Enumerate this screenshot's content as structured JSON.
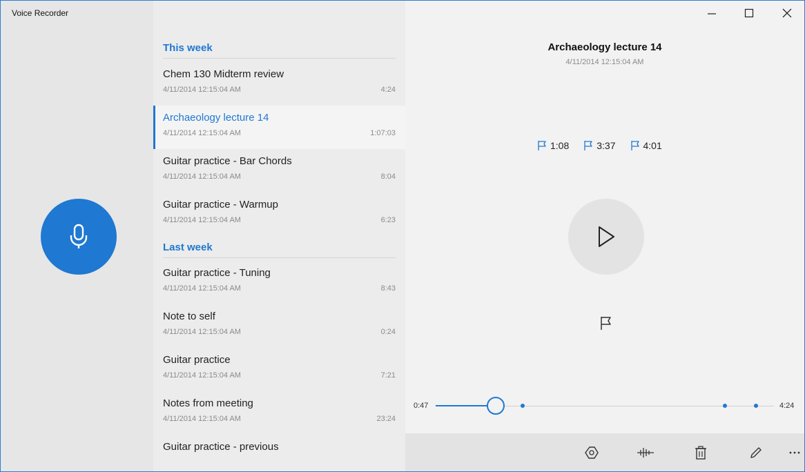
{
  "window": {
    "title": "Voice Recorder",
    "controls": [
      "minimize",
      "maximize",
      "close"
    ]
  },
  "colors": {
    "accent": "#1f78d1",
    "rail": "#e6e6e6",
    "list_bg": "#ececec",
    "player_bg": "#f2f2f2"
  },
  "record_button": {
    "icon": "microphone-icon"
  },
  "groups": [
    {
      "header": "This week",
      "items": [
        {
          "name": "Chem 130 Midterm review",
          "date": "4/11/2014 12:15:04 AM",
          "duration": "4:24",
          "selected": false
        },
        {
          "name": "Archaeology lecture 14",
          "date": "4/11/2014 12:15:04 AM",
          "duration": "1:07:03",
          "selected": true
        },
        {
          "name": "Guitar practice - Bar Chords",
          "date": "4/11/2014 12:15:04 AM",
          "duration": "8:04",
          "selected": false
        },
        {
          "name": "Guitar practice - Warmup",
          "date": "4/11/2014 12:15:04 AM",
          "duration": "6:23",
          "selected": false
        }
      ]
    },
    {
      "header": "Last week",
      "items": [
        {
          "name": "Guitar practice - Tuning",
          "date": "4/11/2014 12:15:04 AM",
          "duration": "8:43",
          "selected": false
        },
        {
          "name": "Note to self",
          "date": "4/11/2014 12:15:04 AM",
          "duration": "0:24",
          "selected": false
        },
        {
          "name": "Guitar practice",
          "date": "4/11/2014 12:15:04 AM",
          "duration": "7:21",
          "selected": false
        },
        {
          "name": "Notes from meeting",
          "date": "4/11/2014 12:15:04 AM",
          "duration": "23:24",
          "selected": false
        },
        {
          "name": "Guitar practice - previous",
          "date": "",
          "duration": "",
          "selected": false
        }
      ]
    }
  ],
  "player": {
    "title": "Archaeology lecture 14",
    "date": "4/11/2014 12:15:04 AM",
    "markers": [
      "1:08",
      "3:37",
      "4:01"
    ],
    "current_time": "0:47",
    "total_time": "4:24",
    "progress_fraction": 0.178,
    "marker_fractions": [
      0.258,
      0.856,
      0.947
    ],
    "play_icon": "play-icon",
    "add_marker_icon": "flag-icon",
    "toolbar": [
      "share-icon",
      "trim-icon",
      "delete-icon",
      "rename-icon",
      "more-icon"
    ]
  }
}
